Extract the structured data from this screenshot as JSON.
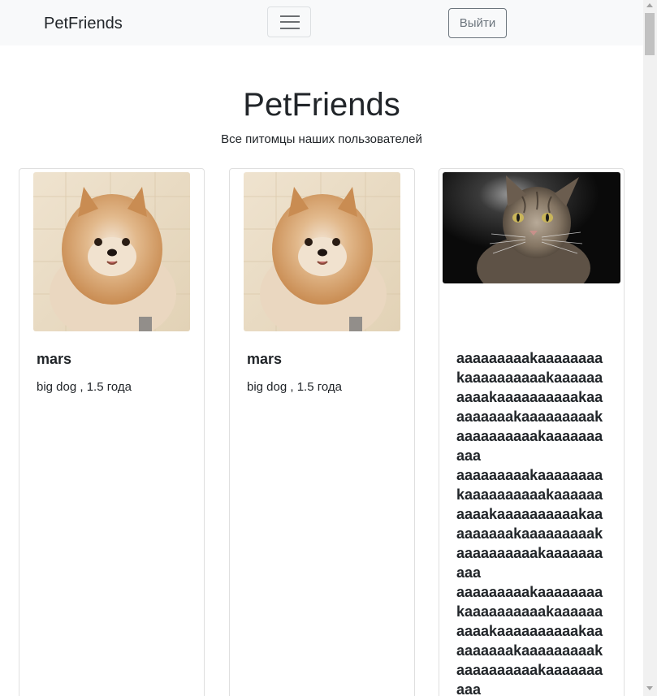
{
  "navbar": {
    "brand": "PetFriends",
    "logout_label": "Выйти"
  },
  "header": {
    "title": "PetFriends",
    "subtitle": "Все питомцы наших пользователей"
  },
  "pets": [
    {
      "name": "mars",
      "info": "big dog , 1.5 года",
      "photo": "pomeranian-dog-photo"
    },
    {
      "name": "mars",
      "info": "big dog , 1.5 года",
      "photo": "pomeranian-dog-photo"
    },
    {
      "name": "aaaaaaaaakaaaaaaaakaaaaaaaaaakaaaaaaaaaakaaaaaaaaaakaaaaaaaaakaaaaaaaaakaaaaaaaaaakaaaaaaaaaa\naaaaaaaaakaaaaaaaakaaaaaaaaaakaaaaaaaaaakaaaaaaaaaakaaaaaaaaakaaaaaaaaakaaaaaaaaaakaaaaaaaaaa\naaaaaaaaakaaaaaaaakaaaaaaaaaakaaaaaaaaaakaaaaaaaaaakaaaaaaaaakaaaaaaaaakaaaaaaaaaakaaaaaaaaaa",
      "info": "",
      "photo": "tabby-cat-photo"
    }
  ],
  "colors": {
    "navbar_bg": "#f8f9fa",
    "logout_border": "#6c757d",
    "card_border": "#dfdfdf"
  }
}
